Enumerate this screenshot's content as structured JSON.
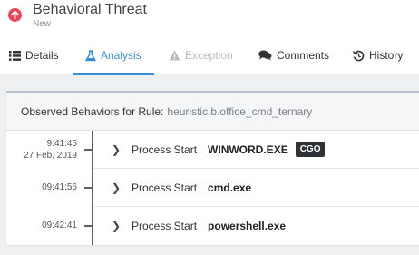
{
  "header": {
    "title": "Behavioral Threat",
    "subtitle": "New",
    "icon": "arrow-up-circle-icon",
    "icon_color": "#e8485a"
  },
  "tabs": [
    {
      "label": "Details",
      "icon": "list-icon",
      "state": "default"
    },
    {
      "label": "Analysis",
      "icon": "flask-icon",
      "state": "active"
    },
    {
      "label": "Exception",
      "icon": "warning-icon",
      "state": "disabled"
    },
    {
      "label": "Comments",
      "icon": "comments-icon",
      "state": "default"
    },
    {
      "label": "History",
      "icon": "history-icon",
      "state": "default"
    }
  ],
  "accent_color": "#3a8fd6",
  "panel": {
    "header_label": "Observed Behaviors for Rule:",
    "rule_name": "heuristic.b.office_cmd_ternary"
  },
  "events": [
    {
      "time": "9:41:45",
      "date": "27 Feb, 2019",
      "label": "Process Start",
      "process": "WINWORD.EXE",
      "badge": "CGO"
    },
    {
      "time": "09:41:56",
      "label": "Process Start",
      "process": "cmd.exe"
    },
    {
      "time": "09:42:41",
      "label": "Process Start",
      "process": "powershell.exe"
    }
  ]
}
